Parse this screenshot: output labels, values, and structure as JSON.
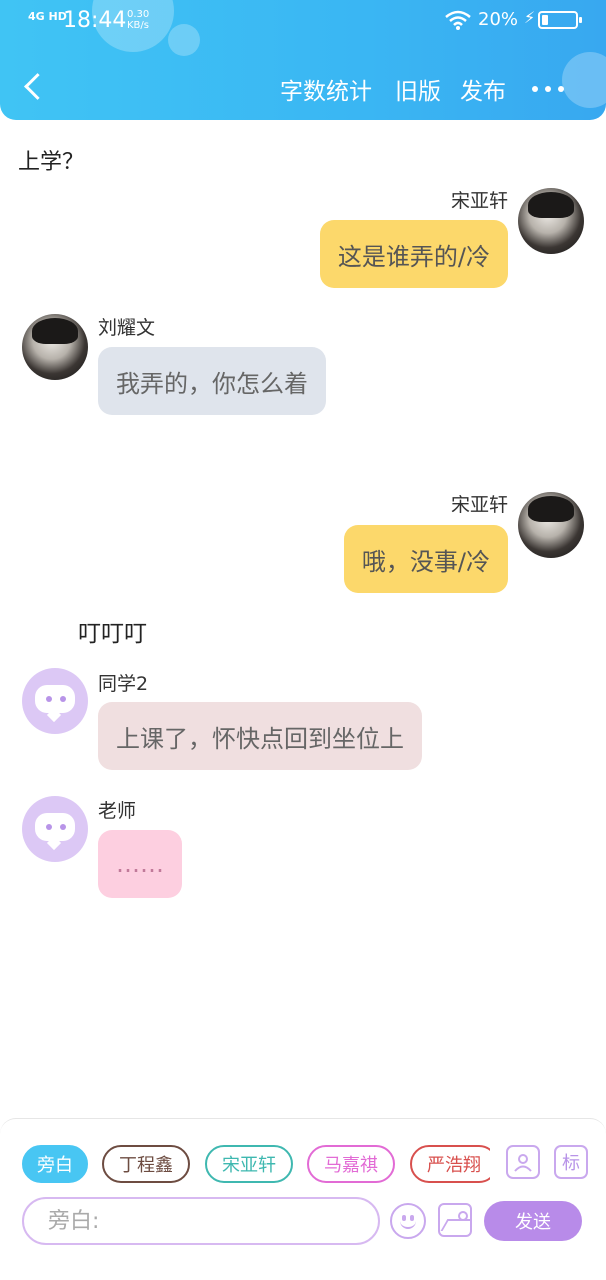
{
  "status_bar": {
    "signal": "4G HD",
    "time": "18:44",
    "net_speed_value": "0.30",
    "net_speed_unit": "KB/s",
    "battery_percent": "20%",
    "battery_level": 0.2,
    "charging_icon": "bolt-icon"
  },
  "header": {
    "back_icon": "chevron-left-icon",
    "actions": [
      "字数统计",
      "旧版",
      "发布"
    ],
    "more_icon": "more-dots-icon"
  },
  "chat": {
    "intro_narration": "上学？",
    "messages": [
      {
        "sender": "宋亚轩",
        "text": "这是谁弄的/冷",
        "side": "right"
      },
      {
        "sender": "刘耀文",
        "text": "我弄的，你怎么着",
        "side": "left"
      },
      {
        "sender": "宋亚轩",
        "text": "哦，没事/冷",
        "side": "right"
      }
    ],
    "narration_2": "叮叮叮",
    "messages_2": [
      {
        "sender": "同学2",
        "text": "上课了，怀快点回到坐位上",
        "side": "left"
      },
      {
        "sender": "老师",
        "text": "……",
        "side": "left"
      }
    ]
  },
  "composer": {
    "role_chips": [
      {
        "label": "旁白",
        "color": "#48c6f3",
        "active": true
      },
      {
        "label": "丁程鑫",
        "color": "#6d4c41",
        "active": false
      },
      {
        "label": "宋亚轩",
        "color": "#3fb8b0",
        "active": false
      },
      {
        "label": "马嘉祺",
        "color": "#e26bd5",
        "active": false
      },
      {
        "label": "严浩翔",
        "color": "#d8504e",
        "active": false
      }
    ],
    "role_icon": "person-icon",
    "tag_label": "标",
    "input_placeholder": "旁白:",
    "emoji_icon": "smiley-icon",
    "image_icon": "image-icon",
    "send_label": "发送"
  },
  "colors": {
    "header": "#3ab6f3",
    "bubble_right": "#fcd86b",
    "bubble_left": "#dfe4ec",
    "accent_purple": "#b88be9"
  }
}
